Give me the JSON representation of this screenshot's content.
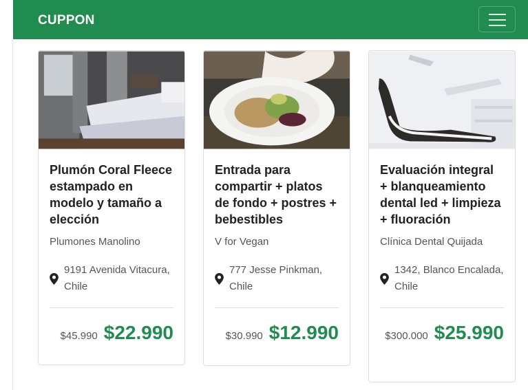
{
  "nav": {
    "brand": "CUPPON",
    "toggler_icon": "hamburger-menu-icon"
  },
  "cards": [
    {
      "title": "Plumón Coral Fleece estampado en modelo y tamaño a elección",
      "merchant": "Plumones Manolino",
      "location": "9191 Avenida Vitacura, Chile",
      "old_price": "$45.990",
      "new_price": "$22.990",
      "image": "bedroom-bed-photo"
    },
    {
      "title": "Entrada para compartir + platos de fondo + postres + bebestibles",
      "merchant": "V for Vegan",
      "location": "777 Jesse Pinkman, Chile",
      "old_price": "$30.990",
      "new_price": "$12.990",
      "image": "vegan-salad-plate-photo"
    },
    {
      "title": "Evaluación integral + blanqueamiento dental led + limpieza + fluoración",
      "merchant": "Clínica Dental Quijada",
      "location": "1342, Blanco Encalada, Chile",
      "old_price": "$300.000",
      "new_price": "$25.990",
      "image": "dental-chair-photo"
    }
  ],
  "colors": {
    "brand_green": "#218c4f",
    "text_dark": "#212121",
    "text_muted": "#555555"
  }
}
